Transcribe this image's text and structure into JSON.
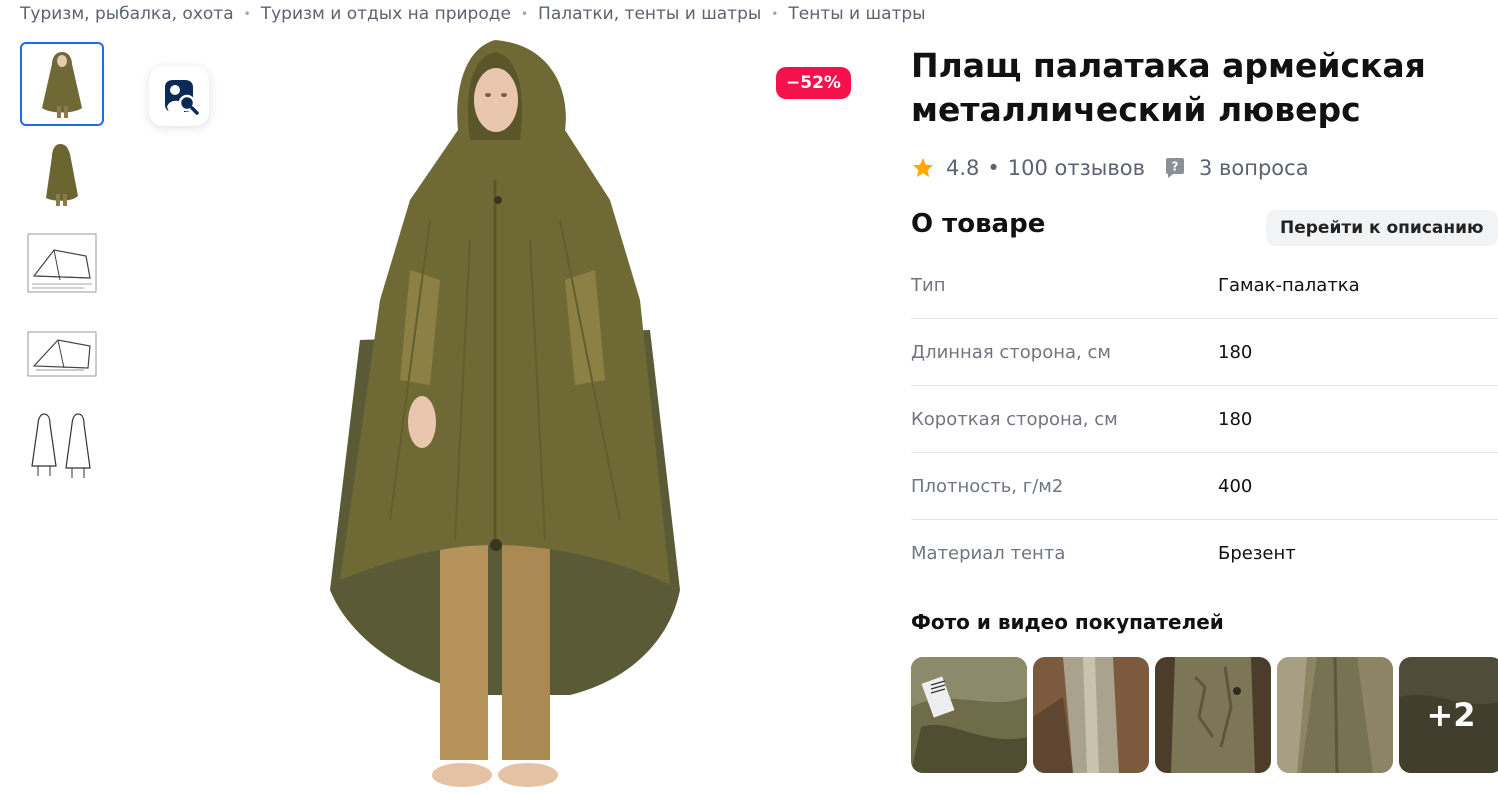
{
  "breadcrumbs": [
    "Туризм, рыбалка, охота",
    "Туризм и отдых на природе",
    "Палатки, тенты и шатры",
    "Тенты и шатры"
  ],
  "breadcrumb_separator": "•",
  "gallery": {
    "thumbnails": [
      "cape-front-photo",
      "cape-side-photo",
      "tent-sketch-1",
      "tent-sketch-2",
      "cape-sketch"
    ],
    "active_index": 0,
    "discount_badge": "−52%"
  },
  "product": {
    "title": "Плащ палатака армейская металлический люверс",
    "rating": "4.8",
    "rating_sep": "•",
    "reviews": "100 отзывов",
    "questions": "3 вопроса"
  },
  "about": {
    "title": "О товаре",
    "goto_description": "Перейти к описанию",
    "specs": [
      {
        "name": "Тип",
        "value": "Гамак-палатка"
      },
      {
        "name": "Длинная сторона, см",
        "value": "180"
      },
      {
        "name": "Короткая сторона, см",
        "value": "180"
      },
      {
        "name": "Плотность, г/м2",
        "value": "400"
      },
      {
        "name": "Материал тента",
        "value": "Брезент"
      }
    ]
  },
  "ugc": {
    "title": "Фото и видео покупателей",
    "more_count": "+2"
  },
  "colors": {
    "accent": "#1f6bf0",
    "discount": "#f5124c",
    "star": "#ffa800",
    "cape": "#6f6a35"
  }
}
